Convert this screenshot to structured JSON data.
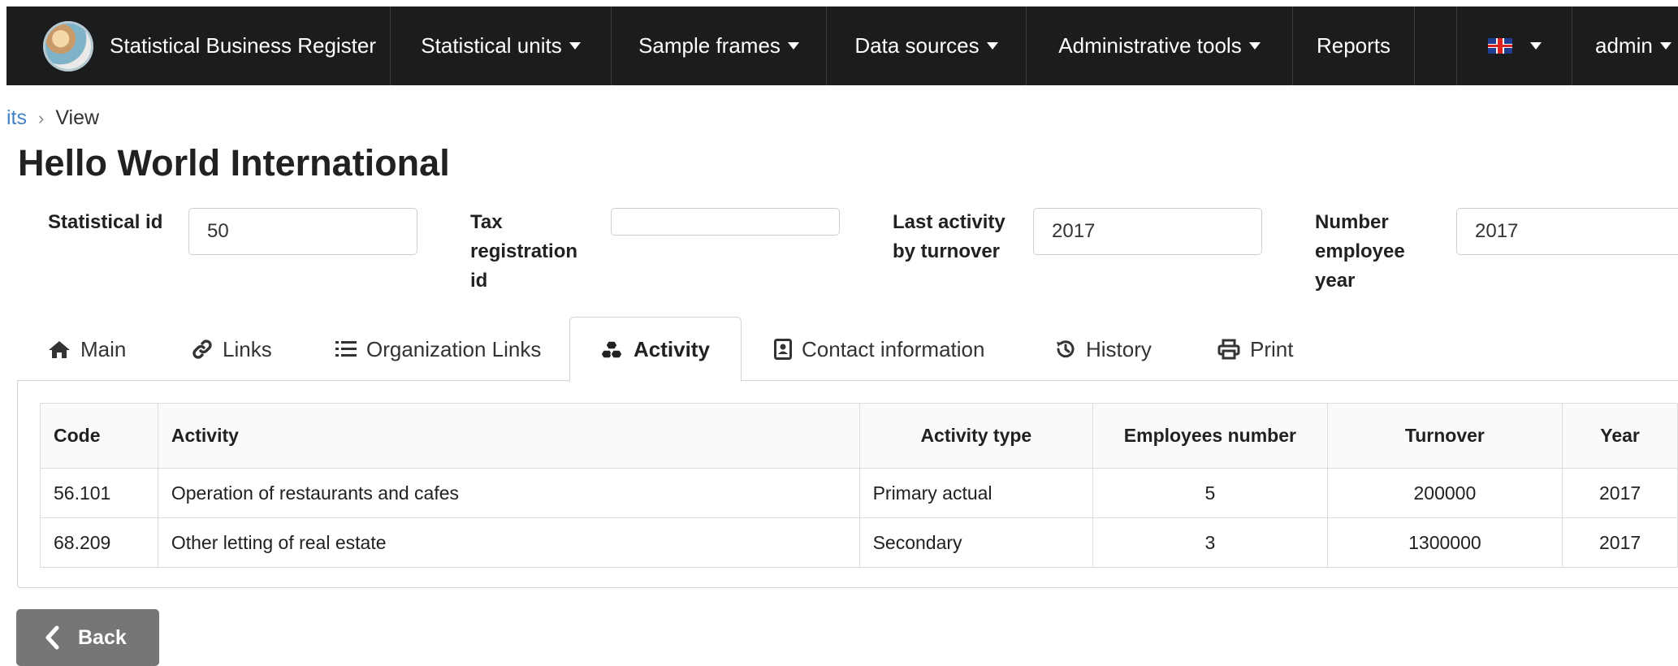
{
  "nav": {
    "brand": "Statistical Business Register",
    "items": [
      {
        "label": "Statistical units",
        "dropdown": true
      },
      {
        "label": "Sample frames",
        "dropdown": true
      },
      {
        "label": "Data sources",
        "dropdown": true
      },
      {
        "label": "Administrative tools",
        "dropdown": true
      },
      {
        "label": "Reports",
        "dropdown": false
      }
    ],
    "language_icon": "uk-flag-icon",
    "user": "admin"
  },
  "breadcrumb": {
    "link": "its",
    "current": "View"
  },
  "title": "Hello World International",
  "fields": {
    "statistical_id": {
      "label": "Statistical id",
      "value": "50"
    },
    "tax_registration_id": {
      "label_lines": [
        "Tax",
        "registration",
        "id"
      ],
      "value": ""
    },
    "last_activity": {
      "label_lines": [
        "Last activity",
        "by turnover"
      ],
      "value": "2017"
    },
    "number_employee_year": {
      "label_lines": [
        "Number",
        "employee",
        "year"
      ],
      "value": "2017"
    }
  },
  "tabs": [
    {
      "label": "Main",
      "icon": "home-icon"
    },
    {
      "label": "Links",
      "icon": "link-icon"
    },
    {
      "label": "Organization Links",
      "icon": "list-icon"
    },
    {
      "label": "Activity",
      "icon": "cubes-icon",
      "active": true
    },
    {
      "label": "Contact information",
      "icon": "address-book-icon"
    },
    {
      "label": "History",
      "icon": "history-icon"
    },
    {
      "label": "Print",
      "icon": "print-icon"
    }
  ],
  "table": {
    "headers": [
      "Code",
      "Activity",
      "Activity type",
      "Employees number",
      "Turnover",
      "Year"
    ],
    "rows": [
      [
        "56.101",
        "Operation of restaurants and cafes",
        "Primary actual",
        "5",
        "200000",
        "2017"
      ],
      [
        "68.209",
        "Other letting of real estate",
        "Secondary",
        "3",
        "1300000",
        "2017"
      ]
    ]
  },
  "back_button": "Back",
  "colors": {
    "navbar": "#1b1c1d",
    "link": "#4183c4",
    "back_button": "#767676"
  }
}
